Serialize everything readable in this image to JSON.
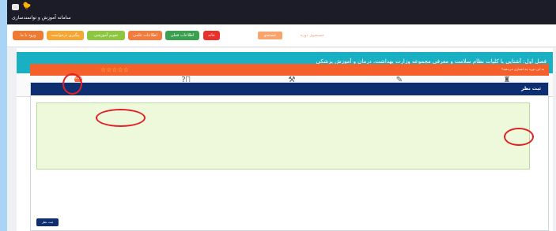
{
  "app": {
    "title": "سامانه آموزش و توانمندسازی",
    "bird_icon": "🐤"
  },
  "nav": {
    "buttons": [
      {
        "label": "ورود با ما",
        "color": "#ef7b32"
      },
      {
        "label": "پیگیری درخواست",
        "color": "#f7a632"
      },
      {
        "label": "تقویم آموزشی",
        "color": "#8dc63f"
      },
      {
        "label": "اطلاعات علمی",
        "color": "#f37b3b"
      },
      {
        "label": "اطلاعات فعلی",
        "color": "#3aa14f"
      },
      {
        "label": "خانه",
        "color": "#e9302a"
      }
    ],
    "search_text": "جستجوی دوره",
    "search_button": "جستجو"
  },
  "course": {
    "title": "فصل اول: آشنایی با کلیات نظام سلامت و معرفی مجموعه وزارت بهداشت، درمان و آموزش پزشکی"
  },
  "tabs": [
    {
      "label": "نظرات",
      "icon": "chat-icon"
    },
    {
      "label": "پرسش",
      "icon": "question-icon"
    },
    {
      "label": "امکانات",
      "icon": "tools-icon"
    },
    {
      "label": "آزمون‌ها",
      "icon": "exam-icon"
    },
    {
      "label": "جلسات",
      "icon": "sessions-icon"
    }
  ],
  "rating": {
    "stars": "☆☆☆☆☆",
    "question": "به این دوره چه امتیازی می‌دهید؟"
  },
  "comment": {
    "header": "ثبت نظر",
    "submit_label": "ثبت نظر"
  },
  "colors": {
    "topbar": "#1c1c29",
    "course_header": "#1ab0c3",
    "rating_bar": "#f5602a",
    "comment_header": "#0d2f72",
    "annotation_ring": "#e21f26"
  }
}
